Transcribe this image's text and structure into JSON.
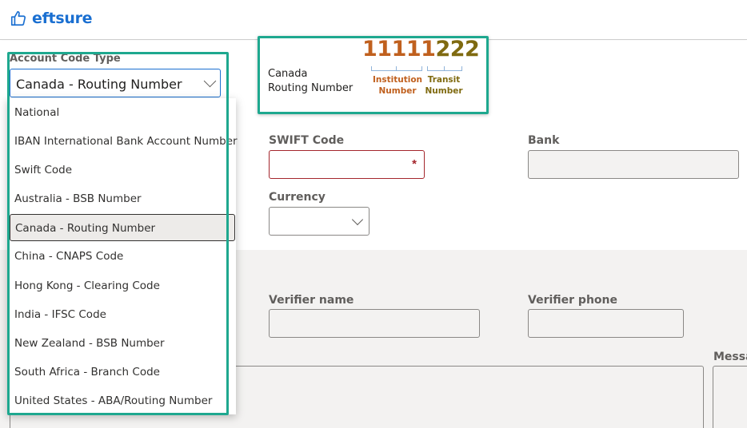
{
  "header": {
    "brand": "eftsure",
    "brand_icon": "thumbs-up-icon"
  },
  "account_code": {
    "label": "Account Code Type",
    "selected": "Canada - Routing Number",
    "options": [
      "National",
      "IBAN International Bank Account Number",
      "Swift Code",
      "Australia - BSB Number",
      "Canada - Routing Number",
      "China - CNAPS Code",
      "Hong Kong - Clearing Code",
      "India - IFSC Code",
      "New Zealand - BSB Number",
      "South Africa - Branch Code",
      "United States - ABA/Routing Number"
    ],
    "selected_index": 4
  },
  "canada_example": {
    "label_line1": "Canada",
    "label_line2": "Routing Number",
    "institution_digits": "11111",
    "transit_digits": "222",
    "institution_cap_1": "Institution",
    "institution_cap_2": "Number",
    "transit_cap_1": "Transit",
    "transit_cap_2": "Number"
  },
  "form": {
    "swift_label": "SWIFT Code",
    "swift_value": "",
    "swift_required": "*",
    "bank_label": "Bank",
    "bank_value": "",
    "currency_label": "Currency",
    "currency_value": "",
    "verifier_name_label": "Verifier name",
    "verifier_name_value": "",
    "verifier_phone_label": "Verifier phone",
    "verifier_phone_value": "",
    "message_label": "Messa"
  },
  "colors": {
    "brand": "#1a6fd1",
    "highlight": "#1ea88f",
    "institution": "#c0601e",
    "transit": "#7f6a10",
    "error": "#a4262c"
  }
}
